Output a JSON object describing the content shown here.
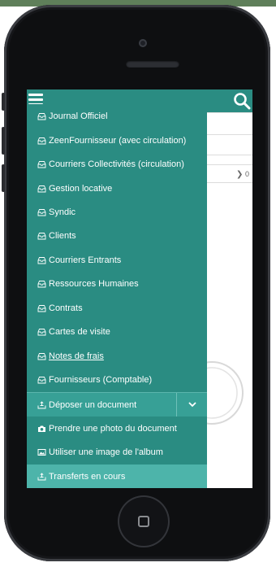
{
  "device": {
    "background_color": "#5f7f5a",
    "frame_color": "#0e0f11",
    "home_button_icon": "square-icon"
  },
  "app": {
    "accent_color": "#2a8c82",
    "topbar": {
      "menu_icon": "hamburger-icon",
      "search_icon": "search-icon"
    },
    "underlying_page": {
      "chevron_icon": "chevron-right-icon",
      "count": "0"
    },
    "drawer": {
      "items": [
        {
          "label": "Journal Officiel",
          "icon": "inbox-icon"
        },
        {
          "label": "ZeenFournisseur (avec circulation)",
          "icon": "inbox-icon"
        },
        {
          "label": "Courriers Collectivités (circulation)",
          "icon": "inbox-icon"
        },
        {
          "label": "Gestion locative",
          "icon": "inbox-icon"
        },
        {
          "label": "Syndic",
          "icon": "inbox-icon"
        },
        {
          "label": "Clients",
          "icon": "inbox-icon"
        },
        {
          "label": "Courriers Entrants",
          "icon": "inbox-icon"
        },
        {
          "label": "Ressources Humaines",
          "icon": "inbox-icon"
        },
        {
          "label": "Contrats",
          "icon": "inbox-icon"
        },
        {
          "label": "Cartes de visite",
          "icon": "inbox-icon"
        },
        {
          "label": "Notes de frais",
          "icon": "inbox-icon"
        },
        {
          "label": "Fournisseurs (Comptable)",
          "icon": "inbox-icon"
        }
      ],
      "deposit": {
        "label": "Déposer un document",
        "icon": "upload-tray-icon",
        "dropdown_icon": "chevron-down-icon"
      },
      "photo": {
        "label": "Prendre une photo du document",
        "icon": "camera-icon"
      },
      "album": {
        "label": "Utiliser une image de l'album",
        "icon": "image-icon"
      },
      "transfers": {
        "label": "Transferts en cours",
        "icon": "upload-tray-icon"
      }
    }
  }
}
